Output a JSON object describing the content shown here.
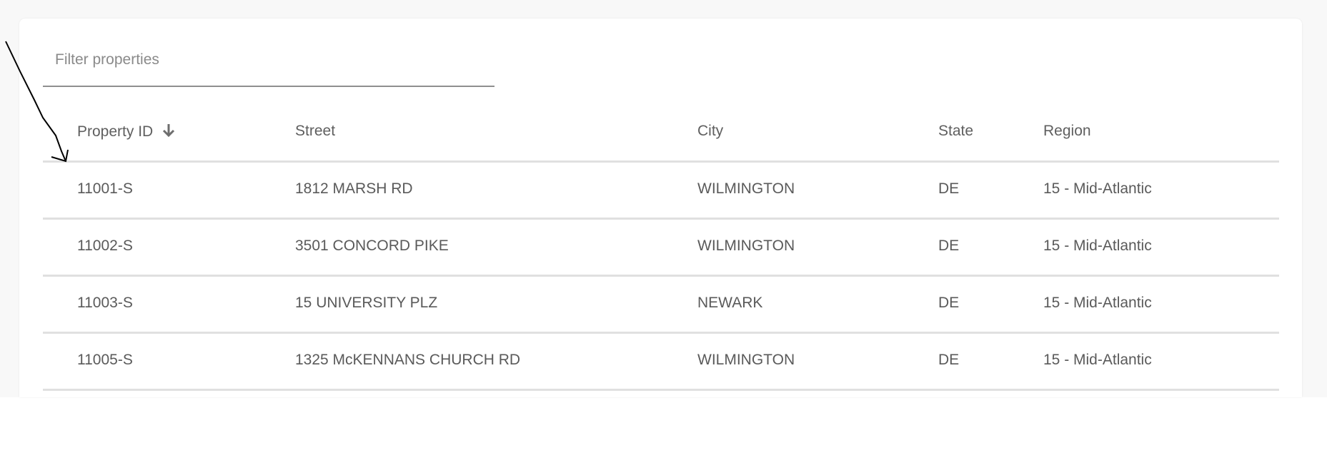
{
  "filter": {
    "placeholder": "Filter properties",
    "value": ""
  },
  "table": {
    "columns": [
      {
        "key": "id",
        "label": "Property ID",
        "sort": "descending-arrow",
        "sort_icon": "arrow-down-icon"
      },
      {
        "key": "street",
        "label": "Street"
      },
      {
        "key": "city",
        "label": "City"
      },
      {
        "key": "state",
        "label": "State"
      },
      {
        "key": "region",
        "label": "Region"
      }
    ],
    "rows": [
      {
        "id": "11001-S",
        "street": "1812 MARSH RD",
        "city": "WILMINGTON",
        "state": "DE",
        "region": "15 - Mid-Atlantic"
      },
      {
        "id": "11002-S",
        "street": "3501 CONCORD PIKE",
        "city": "WILMINGTON",
        "state": "DE",
        "region": "15 - Mid-Atlantic"
      },
      {
        "id": "11003-S",
        "street": "15 UNIVERSITY PLZ",
        "city": "NEWARK",
        "state": "DE",
        "region": "15 - Mid-Atlantic"
      },
      {
        "id": "11005-S",
        "street": "1325 McKENNANS CHURCH RD",
        "city": "WILMINGTON",
        "state": "DE",
        "region": "15 - Mid-Atlantic"
      }
    ]
  },
  "colors": {
    "page_background": "#f8f8f8",
    "card_background": "#ffffff",
    "divider": "#e0e0e0",
    "input_underline": "#8f8f8f",
    "text": "#5a5a5a",
    "annotation": "#000000"
  }
}
